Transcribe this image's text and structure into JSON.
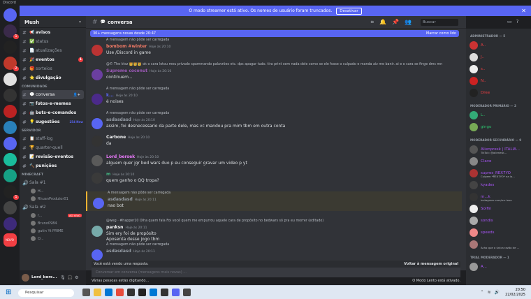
{
  "window": {
    "title": "Discord"
  },
  "notice": {
    "text": "O modo streamer está ativo. Os nomes de usuário foram truncados.",
    "button": "Desativar",
    "close": "✕"
  },
  "guild": {
    "name": "Mush"
  },
  "channels": {
    "top": [
      {
        "label": "avisos",
        "icon": "📢",
        "bold": true
      },
      {
        "label": "status",
        "icon": "✅"
      },
      {
        "label": "atualizações",
        "icon": "📄"
      },
      {
        "label": "eventos",
        "icon": "🎉",
        "bold": true,
        "count": "1"
      },
      {
        "label": "sorteios",
        "icon": "🎁"
      },
      {
        "label": "divulgação",
        "icon": "⭐",
        "bold": true
      }
    ],
    "cat_comunidade": "COMUNIDADE",
    "comunidade": [
      {
        "label": "conversa",
        "icon": "💬",
        "selected": true
      },
      {
        "label": "fotos-e-memes",
        "icon": "📷",
        "bold": true
      },
      {
        "label": "bots-e-comandos",
        "icon": "🤖",
        "bold": true
      },
      {
        "label": "sugestões",
        "icon": "💡",
        "bold": true,
        "extra": "254 New"
      }
    ],
    "cat_servidor": "SERVIDOR",
    "servidor": [
      {
        "label": "staff-log",
        "icon": "📋"
      },
      {
        "label": "quarter-quell",
        "icon": "🏆"
      },
      {
        "label": "revisão-eventos",
        "icon": "📝",
        "bold": true
      },
      {
        "label": "punições",
        "icon": "🔨",
        "bold": true
      }
    ],
    "cat_minecraft": "MINECRAFT",
    "voice": [
      {
        "label": "Sala #1",
        "users": [
          "H...",
          "RhuanProdutor01"
        ]
      },
      {
        "label": "Sala #2",
        "users": [
          "r...",
          "Bruno0984",
          "gutin Yt PRIME",
          "O..."
        ],
        "live": "AO VIVO"
      }
    ]
  },
  "user": {
    "name": "Lord_bers..."
  },
  "header": {
    "channel": "conversa",
    "search_placeholder": "Buscar"
  },
  "newbar": {
    "text": "30+ mensagens novas desde 20:47",
    "action": "Marcar como lido"
  },
  "messages": [
    {
      "ref": "A mensagem não pôde ser carregada",
      "author": "bombom #winter",
      "time": "Hoje às 20:10",
      "body": "Use /Discord in game",
      "color": "#f47b67"
    },
    {
      "ref": "@© The ktsz 👑👑👑 ok o cara lotou meu privado spammando palavrões etc. dps apagar tudo. tira print sem nada dele como se ele fosse o culpado e manda aiz me banir. ai e o cara se finge dms mn",
      "author": "Supreme coconut",
      "time": "Hoje às 20:10",
      "body": "continuem...",
      "color": "#9b59b6"
    },
    {
      "ref": "A mensagem não pôde ser carregada",
      "author": "k...",
      "time": "Hoje às 20:10",
      "body": "é noises",
      "color": "#5865f2"
    },
    {
      "ref": "A mensagem não pôde ser carregada",
      "author": "asdasdasd",
      "time": "Hoje às 20:10",
      "body": "assim, foi desnecessario da parte dele, mas vc mandou pra mim tbm em outra conta",
      "color": "#949ba4"
    },
    {
      "ref": "",
      "author": "Carbone",
      "time": "Hoje às 20:10",
      "body": "da",
      "color": "#f2f3f5"
    },
    {
      "ref": "",
      "author": "Lord_bersek",
      "time": "Hoje às 20:10",
      "body": "alguem quer jgr bed wars duo p eu conseguir gravar um video p yt",
      "color": "#e879f9"
    },
    {
      "ref": "",
      "author": "m",
      "time": "Hoje às 20:10",
      "body": "quem ganho o QQ tropa?",
      "color": "#43b581"
    },
    {
      "ref": "A mensagem não pôde ser carregada",
      "author": "asdasdasd",
      "time": "Hoje às 20:11",
      "body": "nao bot",
      "color": "#949ba4"
    },
    {
      "ref": "@weg · #happer10 Olha quem fala Foi você quem me empurrou aquele cara de propósito no bedwars só pra eu morrer (editado)",
      "author": "panksn",
      "time": "Hoje às 20:11",
      "body": "Sim ery foi de propósito",
      "body2": "Aposenta desse jogo tbm",
      "color": "#f2f3f5"
    },
    {
      "ref": "A mensagem não pôde ser carregada",
      "author": "asdasdasd",
      "time": "Hoje às 20:11",
      "body": "",
      "color": "#949ba4"
    }
  ],
  "reply_bar": {
    "text": "Você está vendo uma resposta.",
    "action": "Voltar à mensagem original"
  },
  "composer": {
    "placeholder": "Conversar em conversa (mensagens mais novas) ..."
  },
  "typing": {
    "text": "Várias pessoas estão digitando...",
    "slow": "O Modo Lento está ativado."
  },
  "member_groups": [
    {
      "title": "ADMINISTRADOR — 5",
      "members": [
        {
          "name": "A..",
          "color": "#f23f43"
        },
        {
          "name": "J..",
          "color": "#f23f43"
        },
        {
          "name": "s..",
          "color": "#f23f43"
        },
        {
          "name": "N..",
          "color": "#f23f43"
        },
        {
          "name": "Dree",
          "color": "#f23f43"
        }
      ]
    },
    {
      "title": "MODERADOR PRIMÁRIO — 2",
      "members": [
        {
          "name": "L..",
          "color": "#2dc770"
        },
        {
          "name": "gingo",
          "color": "#2dc770"
        }
      ]
    },
    {
      "title": "MODERADOR SECUNDÁRIO — 9",
      "members": [
        {
          "name": "Alienpresk | ITALIA...",
          "color": "#a855f7",
          "sub": "TikTok: @alienesk..."
        },
        {
          "name": "Clave",
          "color": "#a855f7"
        },
        {
          "name": "supres_REX7YO",
          "color": "#a855f7",
          "sub": "Cuipem *REX7YO* na la..."
        },
        {
          "name": "kyades",
          "color": "#a855f7"
        },
        {
          "name": "m...k",
          "color": "#a855f7",
          "sub": "instagram.com/mc.leso"
        },
        {
          "name": "Solfin",
          "color": "#a855f7"
        },
        {
          "name": "sondis",
          "color": "#a855f7"
        },
        {
          "name": "speeds",
          "color": "#a855f7"
        },
        {
          "name": "",
          "color": "#a855f7",
          "sub": "Acho que a única razão de ..."
        }
      ]
    },
    {
      "title": "TRIAL MODERADOR — 1",
      "members": [
        {
          "name": "A...",
          "color": "#a855f7"
        }
      ]
    }
  ],
  "taskbar": {
    "search": "Pesquisar",
    "time": "20:50",
    "date": "22/02/2025"
  }
}
